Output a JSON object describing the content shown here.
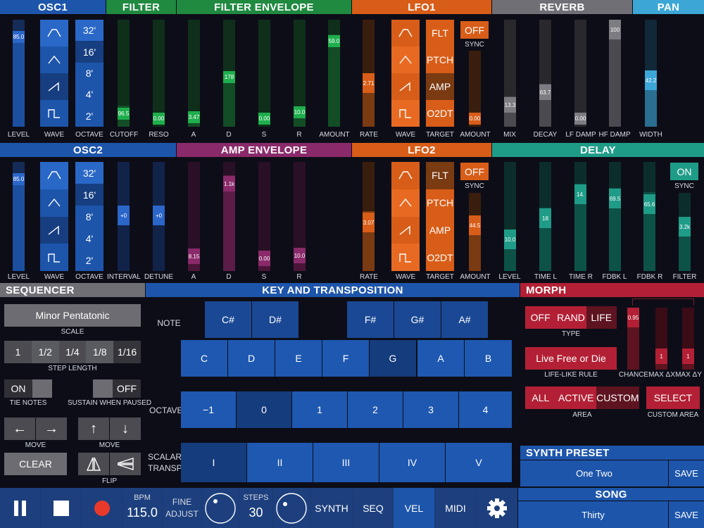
{
  "colors": {
    "blue": "#1d55ab",
    "green": "#1f8a40",
    "greenDark": "#124d26",
    "orange": "#d85d18",
    "orangeDark": "#7a3a12",
    "gray": "#6f6f75",
    "teal": "#1f9c88",
    "tealDark": "#0d5247",
    "purple": "#8a2a6a",
    "purpleDark": "#4a1538",
    "red": "#b32035",
    "redDark": "#5d1420",
    "sky": "#3ca7d6"
  },
  "sections": {
    "osc1": "OSC1",
    "filter": "FILTER",
    "filter_env": "FILTER ENVELOPE",
    "lfo1": "LFO1",
    "reverb": "REVERB",
    "pan": "PAN",
    "osc2": "OSC2",
    "amp_env": "AMP ENVELOPE",
    "lfo2": "LFO2",
    "delay": "DELAY",
    "sequencer": "SEQUENCER",
    "key": "KEY AND TRANSPOSITION",
    "morph": "MORPH",
    "synth_preset": "SYNTH PRESET",
    "song": "SONG"
  },
  "osc1": {
    "level": {
      "label": "LEVEL",
      "value": "85.0",
      "fraction": 0.85
    },
    "wave_label": "WAVE",
    "octave_label": "OCTAVE",
    "octaves": [
      "32'",
      "16'",
      "8'",
      "4'",
      "2'"
    ]
  },
  "filter": {
    "cutoff": {
      "label": "CUTOFF",
      "value": "96.5",
      "fraction": 0.2
    },
    "reso": {
      "label": "RESO",
      "value": "0.00",
      "fraction": 0.0
    }
  },
  "filter_env": {
    "a": {
      "label": "A",
      "value": "3.47",
      "fraction": 0.12
    },
    "d": {
      "label": "D",
      "value": "178",
      "fraction": 0.55
    },
    "s": {
      "label": "S",
      "value": "0.00",
      "fraction": 0
    },
    "r": {
      "label": "R",
      "value": "10.0",
      "fraction": 0.12
    },
    "amount": {
      "label": "AMOUNT",
      "value": "59.0",
      "fraction": 0.85
    }
  },
  "lfo1": {
    "rate": {
      "label": "RATE",
      "value": "2.71",
      "fraction": 0.45
    },
    "wave_label": "WAVE",
    "target_label": "TARGET",
    "targets": [
      "FLT",
      "PTCH",
      "AMP",
      "O2DT"
    ],
    "sync": "OFF",
    "sync_label": "SYNC",
    "amount": {
      "label": "AMOUNT",
      "value": "0.00",
      "fraction": 0
    }
  },
  "reverb": {
    "mix": {
      "label": "MIX",
      "value": "13.3",
      "fraction": 0.28
    },
    "decay": {
      "label": "DECAY",
      "value": "63.7",
      "fraction": 0.45
    },
    "lfdamp": {
      "label": "LF DAMP",
      "value": "0.00",
      "fraction": 0
    },
    "hfdamp": {
      "label": "HF DAMP",
      "value": "100",
      "fraction": 1
    }
  },
  "pan": {
    "width": {
      "label": "WIDTH",
      "value": "42.2",
      "fraction": 0.55
    }
  },
  "osc2": {
    "level": {
      "label": "LEVEL",
      "value": "85.0",
      "fraction": 0.85
    },
    "wave_label": "WAVE",
    "octave_label": "OCTAVE",
    "octaves": [
      "32'",
      "16'",
      "8'",
      "4'",
      "2'"
    ],
    "interval": {
      "label": "INTERVAL",
      "value": "+0"
    },
    "detune": {
      "label": "DETUNE",
      "value": "+0"
    }
  },
  "amp_env": {
    "a": {
      "label": "A",
      "value": "8.15",
      "fraction": 0.15
    },
    "d": {
      "label": "D",
      "value": "1.1k",
      "fraction": 0.9
    },
    "s": {
      "label": "S",
      "value": "0.00",
      "fraction": 0.1
    },
    "r": {
      "label": "R",
      "value": "10.0",
      "fraction": 0.18
    }
  },
  "lfo2": {
    "rate": {
      "label": "RATE",
      "value": "3.07",
      "fraction": 0.55
    },
    "wave_label": "WAVE",
    "target_label": "TARGET",
    "targets": [
      "FLT",
      "PTCH",
      "AMP",
      "O2DT"
    ],
    "sync": "OFF",
    "sync_label": "SYNC",
    "amount": {
      "label": "AMOUNT",
      "value": "44.5",
      "fraction": 0.5
    }
  },
  "delay": {
    "level": {
      "label": "LEVEL",
      "value": "10.0",
      "fraction": 0.35
    },
    "timel": {
      "label": "TIME L",
      "value": "18",
      "fraction": 0.6
    },
    "timer": {
      "label": "TIME R",
      "value": "14.",
      "fraction": 0.8
    },
    "fdbkl": {
      "label": "FDBK L",
      "value": "69.5",
      "fraction": 0.75
    },
    "fdbkr": {
      "label": "FDBK R",
      "value": "65.6",
      "fraction": 0.7
    },
    "filter": {
      "label": "FILTER",
      "value": "3.2k",
      "fraction": 0.5
    },
    "sync": "ON",
    "sync_label": "SYNC"
  },
  "sequencer": {
    "scale": "Minor Pentatonic",
    "scale_label": "SCALE",
    "steps": [
      "1",
      "1/2",
      "1/4",
      "1/8",
      "1/16"
    ],
    "step_length_label": "STEP LENGTH",
    "tie_on": "ON",
    "tie_label": "TIE NOTES",
    "sustain_off": "OFF",
    "sustain_label": "SUSTAIN WHEN PAUSED",
    "move_label1": "MOVE",
    "move_label2": "MOVE",
    "clear": "CLEAR",
    "flip_label": "FLIP"
  },
  "key": {
    "note_label": "NOTE",
    "sharps": [
      "C#",
      "D#",
      "F#",
      "G#",
      "A#"
    ],
    "naturals": [
      "C",
      "D",
      "E",
      "F",
      "G",
      "A",
      "B"
    ],
    "octave_label": "OCTAVE",
    "octaves": [
      "−1",
      "0",
      "1",
      "2",
      "3",
      "4"
    ],
    "scalar_label1": "SCALAR",
    "scalar_label2": "TRANSP.",
    "scalars": [
      "I",
      "II",
      "III",
      "IV",
      "V"
    ]
  },
  "morph": {
    "types": [
      "OFF",
      "RAND",
      "LIFE"
    ],
    "type_label": "TYPE",
    "rule": "Live Free or Die",
    "rule_label": "LIFE-LIKE RULE",
    "chance": {
      "label": "CHANCE",
      "value": "0.95",
      "fraction": 0.95
    },
    "maxdx": {
      "label": "MAX ΔX",
      "value": "1",
      "fraction": 0.3
    },
    "maxdy": {
      "label": "MAX ΔY",
      "value": "1",
      "fraction": 0.3
    },
    "areas": [
      "ALL",
      "ACTIVE",
      "CUSTOM"
    ],
    "area_label": "AREA",
    "select": "SELECT",
    "custom_area_label": "CUSTOM AREA"
  },
  "preset": {
    "name": "One Two",
    "save": "SAVE"
  },
  "song": {
    "name": "Thirty",
    "save": "SAVE"
  },
  "transport": {
    "bpm_label": "BPM",
    "bpm": "115.0",
    "fine1": "FINE",
    "fine2": "ADJUST",
    "steps_label": "STEPS",
    "steps": "30",
    "tabs": [
      "SYNTH",
      "SEQ",
      "VEL",
      "MIDI"
    ]
  }
}
